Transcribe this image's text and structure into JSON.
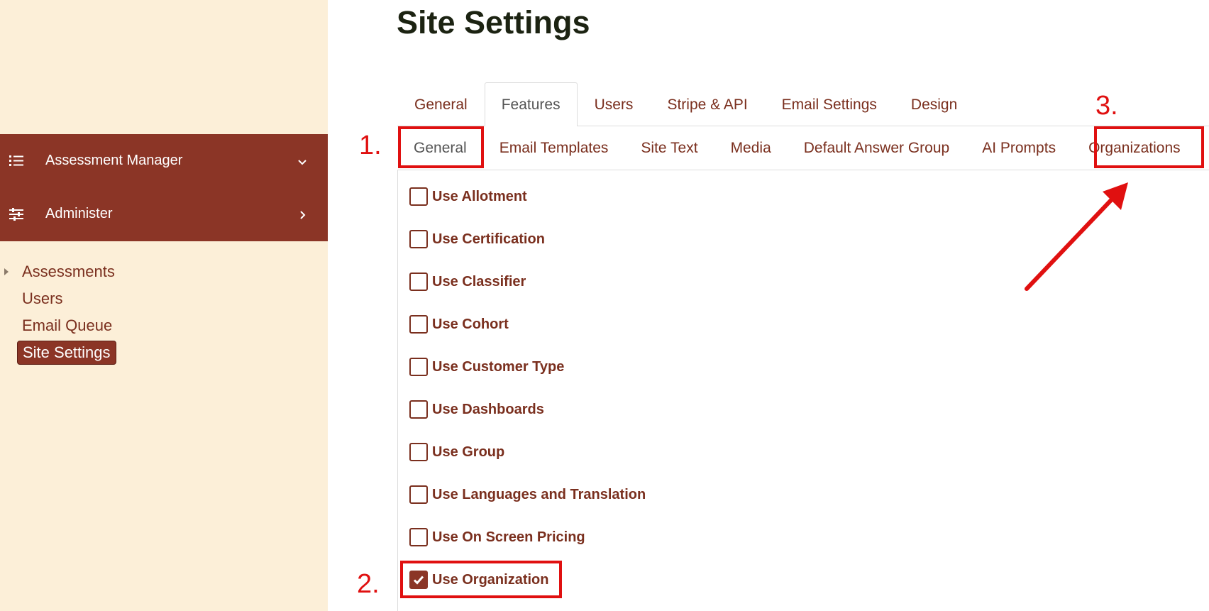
{
  "sidebar": {
    "menu": [
      {
        "label": "Assessment Manager",
        "icon": "list-icon",
        "chevron": "chevron-down-icon"
      },
      {
        "label": "Administer",
        "icon": "sliders-icon",
        "chevron": "chevron-right-icon"
      }
    ],
    "sub_items": [
      {
        "label": "Assessments",
        "has_caret": true,
        "active": false
      },
      {
        "label": "Users",
        "has_caret": false,
        "active": false
      },
      {
        "label": "Email Queue",
        "has_caret": false,
        "active": false
      },
      {
        "label": "Site Settings",
        "has_caret": false,
        "active": true
      }
    ]
  },
  "main": {
    "title": "Site Settings",
    "tabs": [
      {
        "label": "General"
      },
      {
        "label": "Features",
        "active": true
      },
      {
        "label": "Users"
      },
      {
        "label": "Stripe & API"
      },
      {
        "label": "Email Settings"
      },
      {
        "label": "Design"
      }
    ],
    "subtabs": [
      {
        "label": "General",
        "active": true
      },
      {
        "label": "Email Templates"
      },
      {
        "label": "Site Text"
      },
      {
        "label": "Media"
      },
      {
        "label": "Default Answer Group"
      },
      {
        "label": "AI Prompts"
      },
      {
        "label": "Organizations"
      }
    ],
    "features": [
      {
        "label": "Use Allotment",
        "checked": false
      },
      {
        "label": "Use Certification",
        "checked": false
      },
      {
        "label": "Use Classifier",
        "checked": false
      },
      {
        "label": "Use Cohort",
        "checked": false
      },
      {
        "label": "Use Customer Type",
        "checked": false
      },
      {
        "label": "Use Dashboards",
        "checked": false
      },
      {
        "label": "Use Group",
        "checked": false
      },
      {
        "label": "Use Languages and Translation",
        "checked": false
      },
      {
        "label": "Use On Screen Pricing",
        "checked": false
      },
      {
        "label": "Use Organization",
        "checked": true
      }
    ]
  },
  "annotations": {
    "step1": "1.",
    "step2": "2.",
    "step3": "3.",
    "color": "#e01010"
  },
  "colors": {
    "sidebar_bg": "#fcefd8",
    "accent": "#8b3526",
    "text": "#7a2f1e"
  }
}
